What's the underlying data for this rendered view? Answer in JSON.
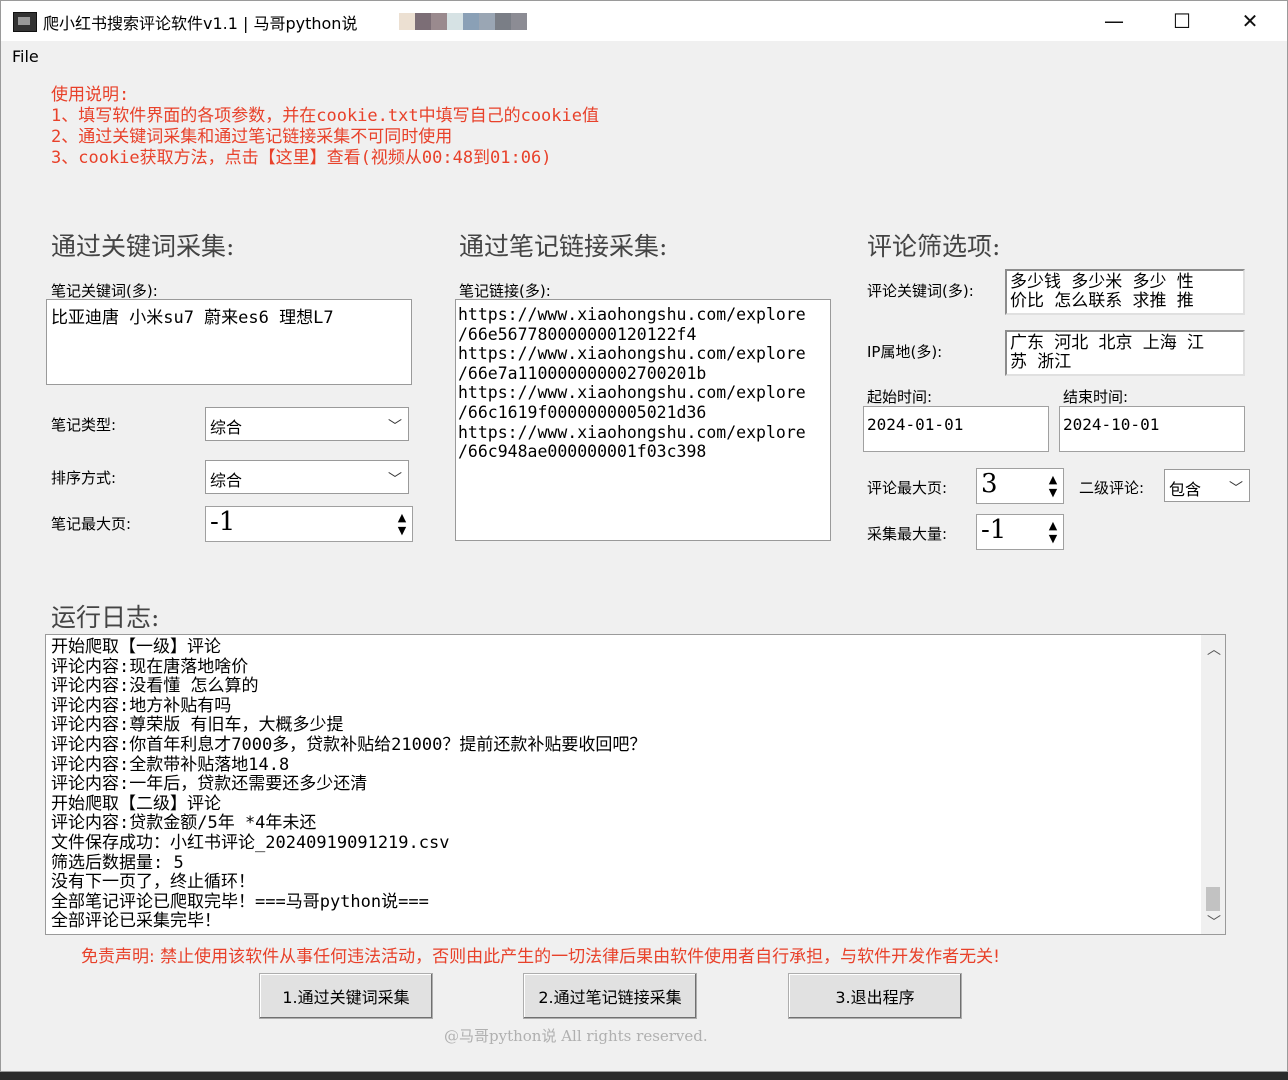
{
  "window": {
    "title": "爬小红书搜索评论软件v1.1 | 马哥python说",
    "minimize": "—",
    "maximize": "☐",
    "close": "✕",
    "title_swatches": [
      "#ece0d2",
      "#7c6e76",
      "#9a8a8e",
      "#d6e2e4",
      "#8aa0b6",
      "#9aa6b4",
      "#7a7e86",
      "#8c8c94"
    ]
  },
  "menu": {
    "file": "File"
  },
  "instructions": {
    "heading": "使用说明:",
    "line1": "1、填写软件界面的各项参数，并在cookie.txt中填写自己的cookie值",
    "line2": "2、通过关键词采集和通过笔记链接采集不可同时使用",
    "line3": "3、cookie获取方法，点击【这里】查看(视频从00:48到01:06)"
  },
  "keyword_section": {
    "title": "通过关键词采集:",
    "keywords_label": "笔记关键词(多):",
    "keywords_value": "比亚迪唐 小米su7 蔚来es6 理想L7",
    "note_type_label": "笔记类型:",
    "note_type_value": "综合",
    "sort_label": "排序方式:",
    "sort_value": "综合",
    "max_page_label": "笔记最大页:",
    "max_page_value": "-1"
  },
  "link_section": {
    "title": "通过笔记链接采集:",
    "links_label": "笔记链接(多):",
    "links_lines": [
      "https://www.xiaohongshu.com/explore",
      "/66e567780000000120122f4",
      "https://www.xiaohongshu.com/explore",
      "/66e7a110000000002700201b",
      "https://www.xiaohongshu.com/explore",
      "/66c1619f0000000005021d36",
      "https://www.xiaohongshu.com/explore",
      "/66c948ae000000001f03c398"
    ]
  },
  "filter_section": {
    "title": "评论筛选项:",
    "comment_kw_label": "评论关键词(多):",
    "comment_kw_lines": [
      "多少钱 多少米 多少 性",
      "价比 怎么联系 求推 推"
    ],
    "ip_label": "IP属地(多):",
    "ip_lines": [
      "广东 河北 北京 上海 江",
      "苏 浙江"
    ],
    "start_label": "起始时间:",
    "start_value": "2024-01-01",
    "end_label": "结束时间:",
    "end_value": "2024-10-01",
    "max_comment_page_label": "评论最大页:",
    "max_comment_page_value": "3",
    "sub_comment_label": "二级评论:",
    "sub_comment_value": "包含",
    "max_count_label": "采集最大量:",
    "max_count_value": "-1"
  },
  "log": {
    "title": "运行日志:",
    "lines": [
      "开始爬取【一级】评论",
      "评论内容:现在唐落地啥价",
      "评论内容:没看懂 怎么算的",
      "评论内容:地方补贴有吗",
      "评论内容:尊荣版 有旧车，大概多少提",
      "评论内容:你首年利息才7000多，贷款补贴给21000？提前还款补贴要收回吧？",
      "评论内容:全款带补贴落地14.8",
      "评论内容:一年后，贷款还需要还多少还清",
      "开始爬取【二级】评论",
      "评论内容:贷款金额/5年 *4年未还",
      "文件保存成功：小红书评论_20240919091219.csv",
      "筛选后数据量: 5",
      "没有下一页了，终止循环！",
      "全部笔记评论已爬取完毕！===马哥python说===",
      "全部评论已采集完毕！"
    ]
  },
  "disclaimer": "免责声明: 禁止使用该软件从事任何违法活动，否则由此产生的一切法律后果由软件使用者自行承担，与软件开发作者无关!",
  "buttons": {
    "keyword": "1.通过关键词采集",
    "link": "2.通过笔记链接采集",
    "exit": "3.退出程序"
  },
  "footer": "@马哥python说 All rights reserved.",
  "colors": {
    "accent_red": "#e8412a",
    "window_bg": "#f0f0f0"
  }
}
